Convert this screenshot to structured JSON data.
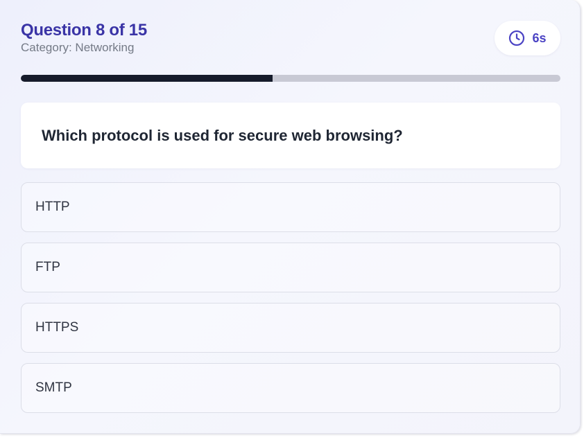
{
  "header": {
    "title": "Question 8 of 15",
    "category": "Category: Networking"
  },
  "timer": {
    "icon": "clock-icon",
    "value": "6s"
  },
  "progress": {
    "fraction": 0.4667
  },
  "question": {
    "text": "Which protocol is used for secure web browsing?"
  },
  "options": [
    {
      "label": "HTTP"
    },
    {
      "label": "FTP"
    },
    {
      "label": "HTTPS"
    },
    {
      "label": "SMTP"
    }
  ],
  "colors": {
    "accent": "#3a34a6",
    "timer_accent": "#4b43c4",
    "progress_fill": "#161b2b",
    "progress_track": "#c8c9d4"
  }
}
